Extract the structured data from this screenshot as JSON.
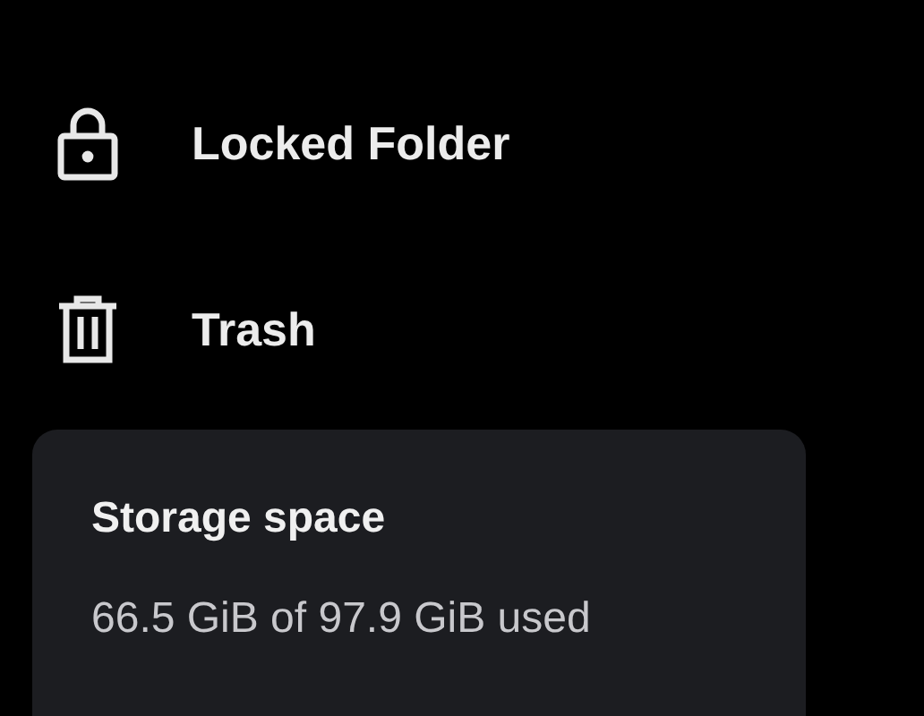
{
  "menu_items": [
    {
      "kind": "lock",
      "label": "Locked Folder"
    },
    {
      "kind": "trash",
      "label": "Trash"
    }
  ],
  "storage": {
    "title": "Storage space",
    "usage": "66.5 GiB of 97.9 GiB used"
  }
}
